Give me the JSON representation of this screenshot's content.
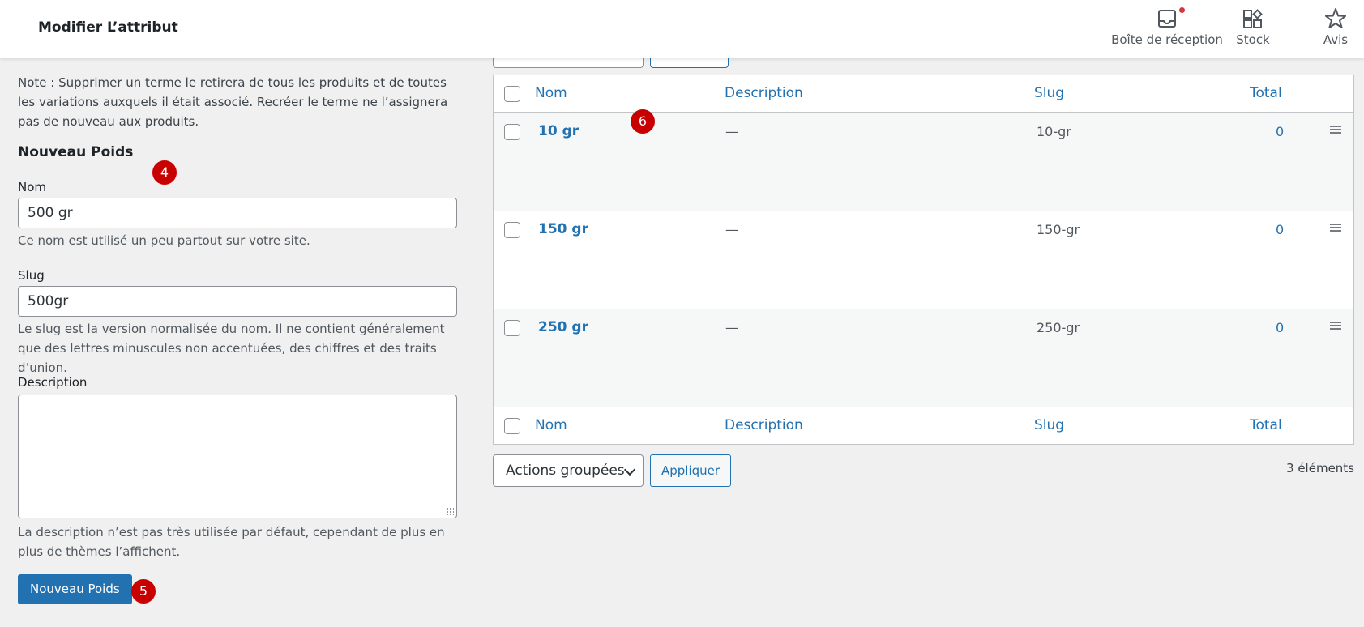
{
  "header": {
    "title": "Modifier L’attribut",
    "items": [
      {
        "label": "Boîte de réception",
        "icon": "inbox-icon"
      },
      {
        "label": "Stock",
        "icon": "stock-icon"
      },
      {
        "label": "Avis",
        "icon": "star-icon"
      }
    ],
    "notification_color": "#d63638"
  },
  "form": {
    "note": "Note : Supprimer un terme le retirera de tous les produits et de toutes les variations auxquels il était associé. Recréer le terme ne l’assignera pas de nouveau aux produits.",
    "section_title": "Nouveau Poids",
    "name_label": "Nom",
    "name_value": "500 gr",
    "name_help": "Ce nom est utilisé un peu partout sur votre site.",
    "slug_label": "Slug",
    "slug_value": "500gr",
    "slug_help": "Le slug est la version normalisée du nom. Il ne contient généralement que des lettres minuscules non accentuées, des chiffres et des traits d’union.",
    "description_label": "Description",
    "description_value": "",
    "description_help": "La description n’est pas très utilisée par défaut, cependant de plus en plus de thèmes l’affichent.",
    "submit_label": "Nouveau Poids"
  },
  "badges": {
    "form": "4",
    "submit": "5",
    "table": "6"
  },
  "table": {
    "columns": {
      "name": "Nom",
      "description": "Description",
      "slug": "Slug",
      "total": "Total"
    },
    "rows": [
      {
        "name": "10 gr",
        "description": "—",
        "slug": "10-gr",
        "total": "0"
      },
      {
        "name": "150 gr",
        "description": "—",
        "slug": "150-gr",
        "total": "0"
      },
      {
        "name": "250 gr",
        "description": "—",
        "slug": "250-gr",
        "total": "0"
      }
    ]
  },
  "bulk": {
    "select_value": "Actions groupées",
    "apply_label": "Appliquer",
    "count": "3 éléments"
  },
  "colors": {
    "accent": "#2271b1",
    "badge": "#c80000",
    "background": "#f0f0f1"
  }
}
